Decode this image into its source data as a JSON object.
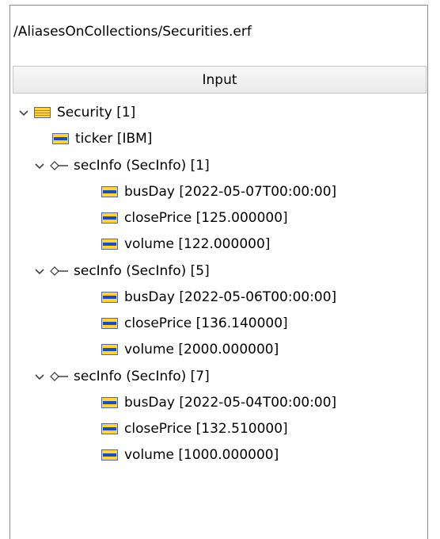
{
  "path": "/AliasesOnCollections/Securities.erf",
  "header": {
    "label": "Input"
  },
  "tree": {
    "root": {
      "label": "Security [1]",
      "icon": "record-icon",
      "expanded": true
    },
    "ticker": {
      "label": "ticker [IBM]",
      "icon": "field-icon"
    },
    "groups": [
      {
        "label": "secInfo (SecInfo) [1]",
        "icon": "relationship-icon",
        "expanded": true,
        "fields": [
          {
            "label": "busDay [2022-05-07T00:00:00]",
            "icon": "field-icon"
          },
          {
            "label": "closePrice [125.000000]",
            "icon": "field-icon"
          },
          {
            "label": "volume [122.000000]",
            "icon": "field-icon"
          }
        ]
      },
      {
        "label": "secInfo (SecInfo) [5]",
        "icon": "relationship-icon",
        "expanded": true,
        "fields": [
          {
            "label": "busDay [2022-05-06T00:00:00]",
            "icon": "field-icon"
          },
          {
            "label": "closePrice [136.140000]",
            "icon": "field-icon"
          },
          {
            "label": "volume [2000.000000]",
            "icon": "field-icon"
          }
        ]
      },
      {
        "label": "secInfo (SecInfo) [7]",
        "icon": "relationship-icon",
        "expanded": true,
        "fields": [
          {
            "label": "busDay [2022-05-04T00:00:00]",
            "icon": "field-icon"
          },
          {
            "label": "closePrice [132.510000]",
            "icon": "field-icon"
          },
          {
            "label": "volume [1000.000000]",
            "icon": "field-icon"
          }
        ]
      }
    ]
  },
  "colors": {
    "icon_fill": "#ffd24a",
    "icon_border": "#5a6a8a",
    "icon_stripe": "#1f4fa8",
    "border": "#8c8c8c"
  }
}
